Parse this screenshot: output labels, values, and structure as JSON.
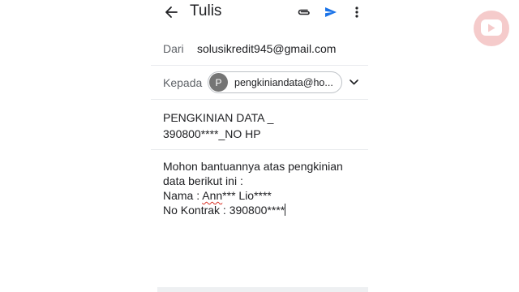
{
  "app": {
    "title": "Tulis"
  },
  "toolbar": {
    "back_icon": "arrow-back-icon",
    "attach_icon": "paperclip-icon",
    "send_icon": "send-icon",
    "more_icon": "more-vertical-icon",
    "accent_color": "#1a73e8"
  },
  "from": {
    "label": "Dari",
    "value": "solusikredit945@gmail.com"
  },
  "to": {
    "label": "Kepada",
    "chip_initial": "P",
    "chip_text": "pengkiniandata@ho...",
    "expand_icon": "chevron-down-icon"
  },
  "subject": {
    "line1": "PENGKINIAN DATA _",
    "line2": "390800****_NO HP"
  },
  "body": {
    "line1": "Mohon bantuannya atas pengkinian",
    "line2": "data berikut ini :",
    "line3_prefix": "Nama : ",
    "line3_flagged": "Ann",
    "line3_suffix": "*** Lio****",
    "line4": "No Kontrak : 390800****"
  },
  "watermark": {
    "icon": "youtube-play-icon",
    "color": "#f4c3c3"
  }
}
